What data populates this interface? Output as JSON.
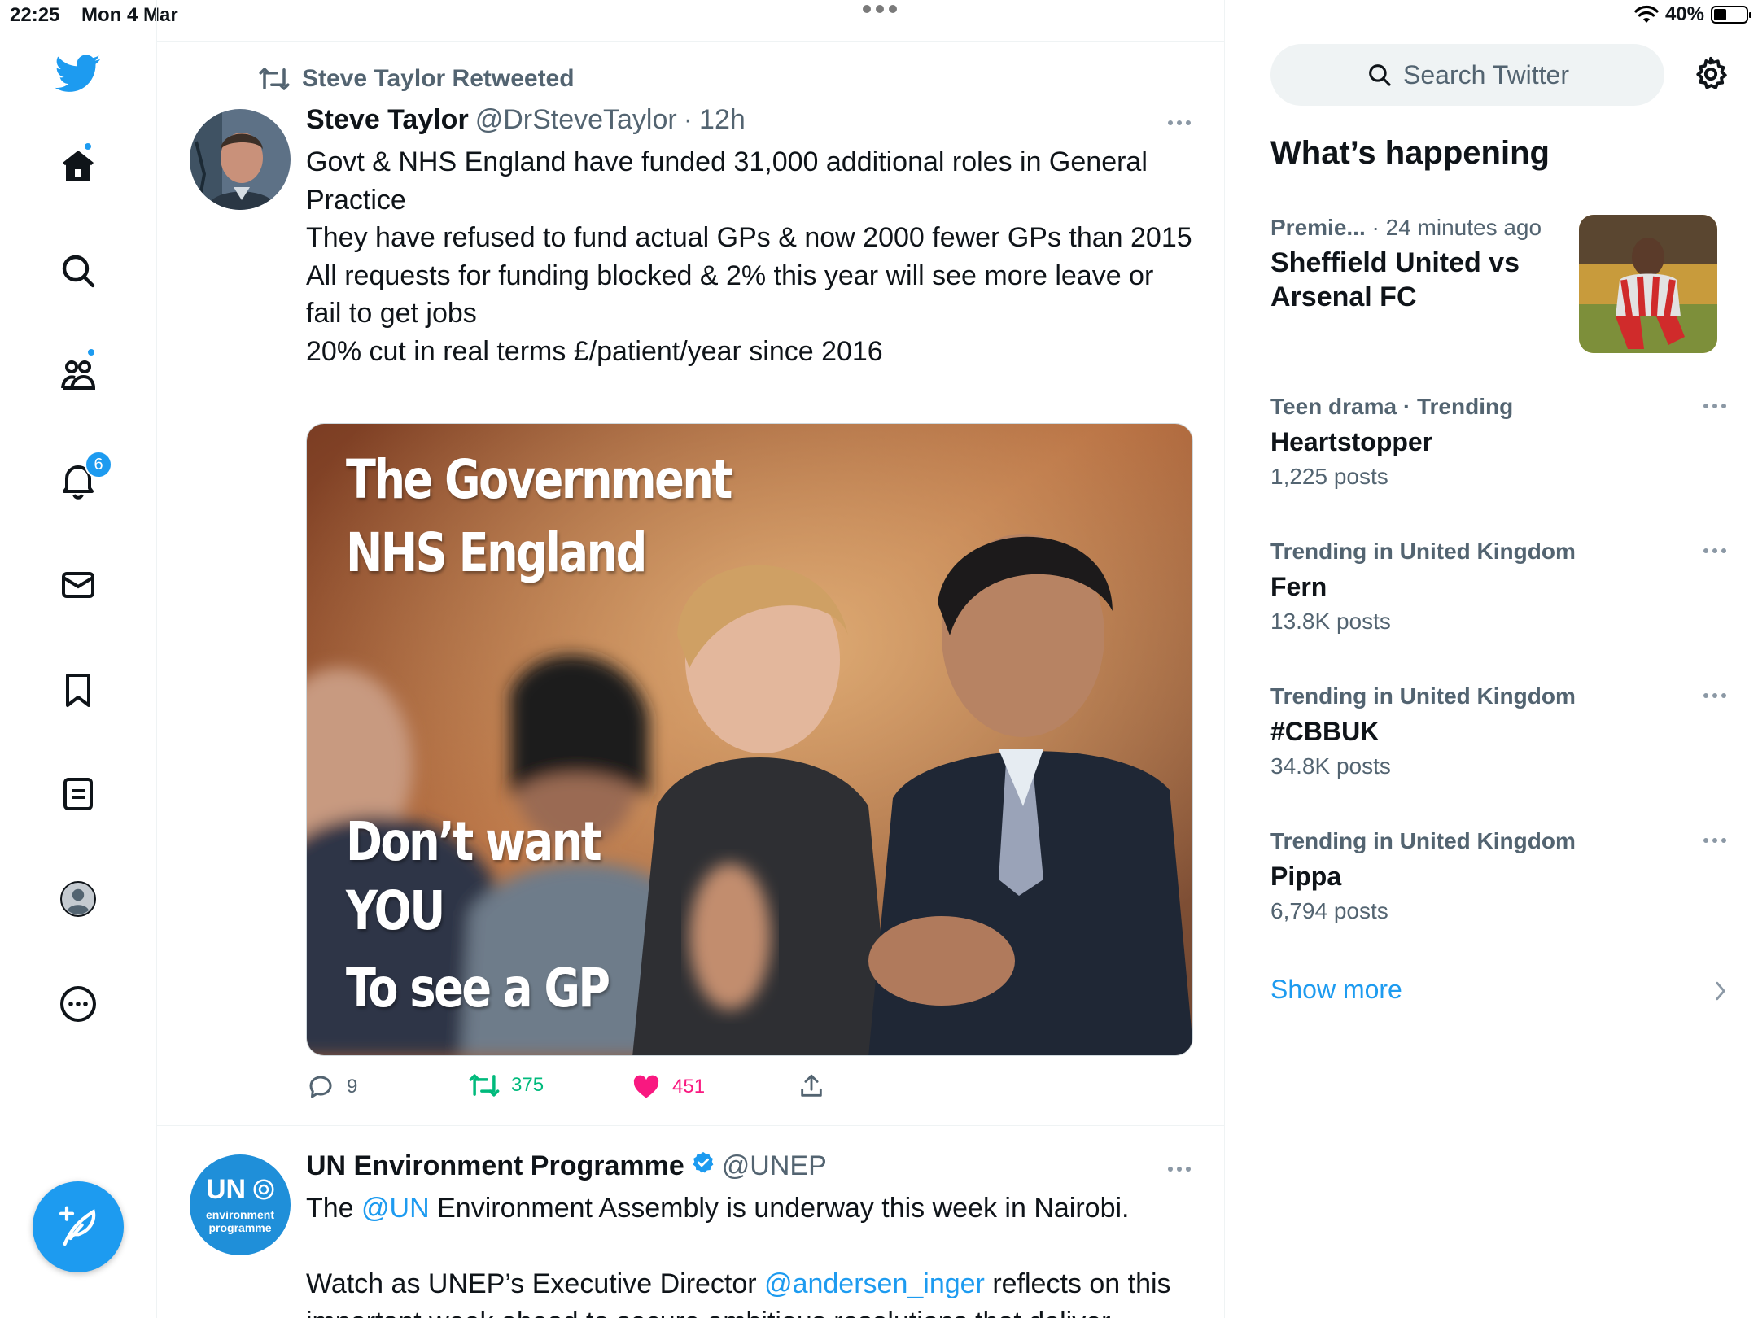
{
  "status_bar": {
    "time": "22:25",
    "date": "Mon 4 Mar",
    "battery": "40%",
    "battery_level": 0.4
  },
  "nav": {
    "notifications_badge": "6",
    "items": [
      "home-icon",
      "search-icon",
      "communities-icon",
      "bell-icon",
      "mail-icon",
      "bookmark-icon",
      "lists-icon",
      "profile-icon",
      "more-circle-icon"
    ],
    "compose_icon": "feather-plus-icon"
  },
  "tweets": [
    {
      "retweeted_by": "Steve Taylor Retweeted",
      "name": "Steve Taylor",
      "handle": "@DrSteveTaylor",
      "separator": "·",
      "time": "12h",
      "text_lines": [
        "Govt & NHS England have funded 31,000 additional roles in General Practice",
        "They have refused to fund actual GPs & now 2000 fewer GPs than 2015",
        "All requests for funding blocked & 2% this year will see more leave or fail to get jobs",
        "20% cut in real terms £/patient/year since 2016"
      ],
      "media_text": {
        "line1": "The Government",
        "line2": "NHS England",
        "line3": "Don’t want",
        "line4": "YOU",
        "line5": "To see a GP"
      },
      "replies": "9",
      "retweets": "375",
      "likes": "451"
    },
    {
      "name": "UN Environment Programme",
      "handle": "@UNEP",
      "avatar_text": {
        "top": "UN",
        "mid": "environment",
        "bottom": "programme"
      },
      "text_p1_pre": "The ",
      "text_p1_link": "@UN",
      "text_p1_post": " Environment Assembly is underway this week in Nairobi.",
      "text_p2_pre": "Watch as UNEP’s Executive Director ",
      "text_p2_link": "@andersen_inger",
      "text_p2_post": " reflects on this",
      "text_p3": "important week ahead to secure ambitious resolutions that deliver"
    }
  ],
  "sidebar": {
    "search_placeholder": "Search Twitter",
    "title": "What’s happening",
    "trends": [
      {
        "category": "Premie...",
        "meta_suffix": " · 24 minutes ago",
        "title": "Sheffield United vs Arsenal FC",
        "count": ""
      },
      {
        "category": "Teen drama · Trending",
        "title": "Heartstopper",
        "count": "1,225 posts"
      },
      {
        "category": "Trending in United Kingdom",
        "title": "Fern",
        "count": "13.8K posts"
      },
      {
        "category": "Trending in United Kingdom",
        "title": "#CBBUK",
        "count": "34.8K posts"
      },
      {
        "category": "Trending in United Kingdom",
        "title": "Pippa",
        "count": "6,794 posts"
      }
    ],
    "show_more": "Show more"
  },
  "colors": {
    "accent": "#1d9bf0",
    "retweet": "#00ba7c",
    "like": "#f91880",
    "muted": "#536471"
  }
}
